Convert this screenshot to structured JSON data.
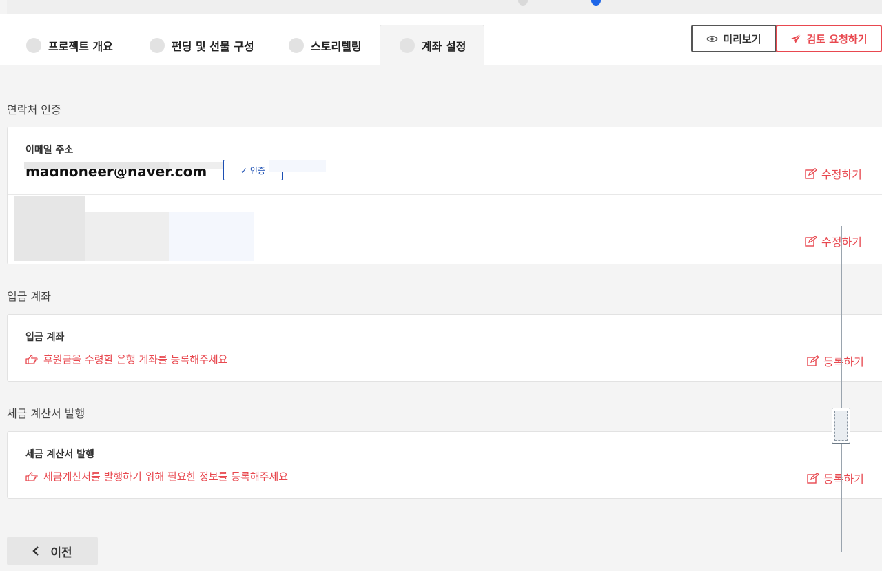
{
  "tabs": [
    {
      "label": "프로젝트 개요"
    },
    {
      "label": "펀딩 및 선물 구성"
    },
    {
      "label": "스토리텔링"
    },
    {
      "label": "계좌 설정"
    }
  ],
  "actions": {
    "preview_label": "미리보기",
    "review_label": "검토 요청하기"
  },
  "contact": {
    "section_title": "연락처 인증",
    "email_label": "이메일 주소",
    "email_value": "madnoneer@naver.com",
    "email_badge": "✓ 인증",
    "edit_label": "수정하기"
  },
  "deposit": {
    "section_title": "입금 계좌",
    "field_label": "입금 계좌",
    "hint": "후원금을 수령할 은행 계좌를 등록해주세요",
    "register_label": "등록하기"
  },
  "tax": {
    "section_title": "세금 계산서 발행",
    "field_label": "세금 계산서 발행",
    "hint": "세금계산서를 발행하기 위해 필요한 정보를 등록해주세요",
    "register_label": "등록하기"
  },
  "footer": {
    "prev_label": "이전"
  },
  "colors": {
    "accent": "#e8484f",
    "verified": "#1c4fb3",
    "progress_dot": "#1e66e8"
  }
}
